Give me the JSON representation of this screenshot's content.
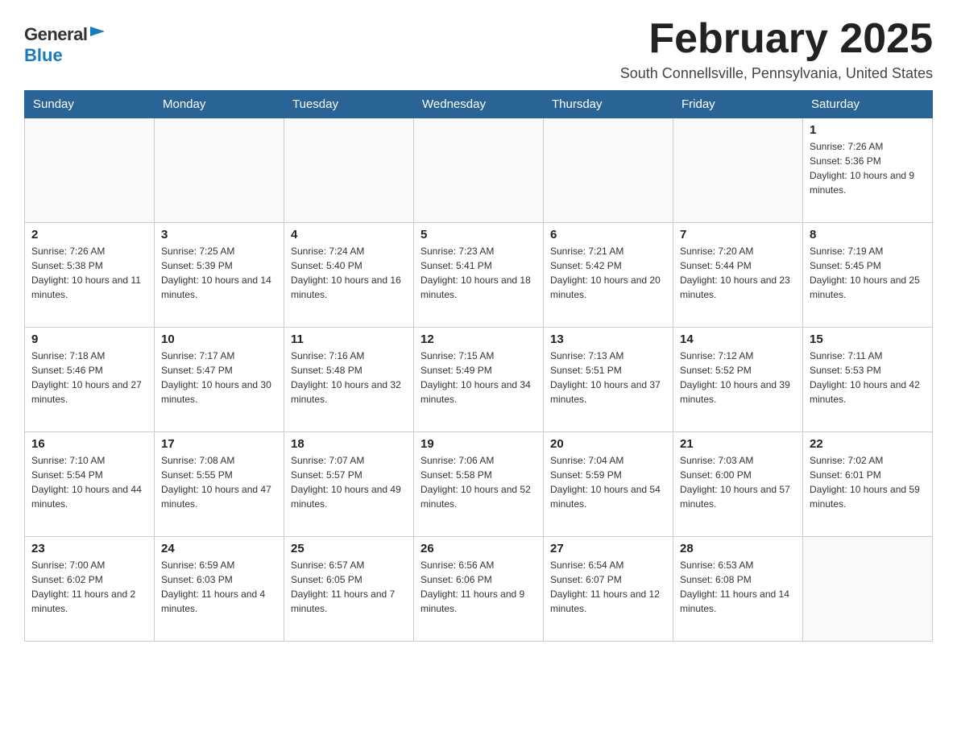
{
  "header": {
    "logo_general": "General",
    "logo_blue": "Blue",
    "month_title": "February 2025",
    "location": "South Connellsville, Pennsylvania, United States"
  },
  "days_of_week": [
    "Sunday",
    "Monday",
    "Tuesday",
    "Wednesday",
    "Thursday",
    "Friday",
    "Saturday"
  ],
  "weeks": [
    {
      "days": [
        {
          "number": "",
          "info": "",
          "empty": true
        },
        {
          "number": "",
          "info": "",
          "empty": true
        },
        {
          "number": "",
          "info": "",
          "empty": true
        },
        {
          "number": "",
          "info": "",
          "empty": true
        },
        {
          "number": "",
          "info": "",
          "empty": true
        },
        {
          "number": "",
          "info": "",
          "empty": true
        },
        {
          "number": "1",
          "info": "Sunrise: 7:26 AM\nSunset: 5:36 PM\nDaylight: 10 hours and 9 minutes."
        }
      ]
    },
    {
      "days": [
        {
          "number": "2",
          "info": "Sunrise: 7:26 AM\nSunset: 5:38 PM\nDaylight: 10 hours and 11 minutes."
        },
        {
          "number": "3",
          "info": "Sunrise: 7:25 AM\nSunset: 5:39 PM\nDaylight: 10 hours and 14 minutes."
        },
        {
          "number": "4",
          "info": "Sunrise: 7:24 AM\nSunset: 5:40 PM\nDaylight: 10 hours and 16 minutes."
        },
        {
          "number": "5",
          "info": "Sunrise: 7:23 AM\nSunset: 5:41 PM\nDaylight: 10 hours and 18 minutes."
        },
        {
          "number": "6",
          "info": "Sunrise: 7:21 AM\nSunset: 5:42 PM\nDaylight: 10 hours and 20 minutes."
        },
        {
          "number": "7",
          "info": "Sunrise: 7:20 AM\nSunset: 5:44 PM\nDaylight: 10 hours and 23 minutes."
        },
        {
          "number": "8",
          "info": "Sunrise: 7:19 AM\nSunset: 5:45 PM\nDaylight: 10 hours and 25 minutes."
        }
      ]
    },
    {
      "days": [
        {
          "number": "9",
          "info": "Sunrise: 7:18 AM\nSunset: 5:46 PM\nDaylight: 10 hours and 27 minutes."
        },
        {
          "number": "10",
          "info": "Sunrise: 7:17 AM\nSunset: 5:47 PM\nDaylight: 10 hours and 30 minutes."
        },
        {
          "number": "11",
          "info": "Sunrise: 7:16 AM\nSunset: 5:48 PM\nDaylight: 10 hours and 32 minutes."
        },
        {
          "number": "12",
          "info": "Sunrise: 7:15 AM\nSunset: 5:49 PM\nDaylight: 10 hours and 34 minutes."
        },
        {
          "number": "13",
          "info": "Sunrise: 7:13 AM\nSunset: 5:51 PM\nDaylight: 10 hours and 37 minutes."
        },
        {
          "number": "14",
          "info": "Sunrise: 7:12 AM\nSunset: 5:52 PM\nDaylight: 10 hours and 39 minutes."
        },
        {
          "number": "15",
          "info": "Sunrise: 7:11 AM\nSunset: 5:53 PM\nDaylight: 10 hours and 42 minutes."
        }
      ]
    },
    {
      "days": [
        {
          "number": "16",
          "info": "Sunrise: 7:10 AM\nSunset: 5:54 PM\nDaylight: 10 hours and 44 minutes."
        },
        {
          "number": "17",
          "info": "Sunrise: 7:08 AM\nSunset: 5:55 PM\nDaylight: 10 hours and 47 minutes."
        },
        {
          "number": "18",
          "info": "Sunrise: 7:07 AM\nSunset: 5:57 PM\nDaylight: 10 hours and 49 minutes."
        },
        {
          "number": "19",
          "info": "Sunrise: 7:06 AM\nSunset: 5:58 PM\nDaylight: 10 hours and 52 minutes."
        },
        {
          "number": "20",
          "info": "Sunrise: 7:04 AM\nSunset: 5:59 PM\nDaylight: 10 hours and 54 minutes."
        },
        {
          "number": "21",
          "info": "Sunrise: 7:03 AM\nSunset: 6:00 PM\nDaylight: 10 hours and 57 minutes."
        },
        {
          "number": "22",
          "info": "Sunrise: 7:02 AM\nSunset: 6:01 PM\nDaylight: 10 hours and 59 minutes."
        }
      ]
    },
    {
      "days": [
        {
          "number": "23",
          "info": "Sunrise: 7:00 AM\nSunset: 6:02 PM\nDaylight: 11 hours and 2 minutes."
        },
        {
          "number": "24",
          "info": "Sunrise: 6:59 AM\nSunset: 6:03 PM\nDaylight: 11 hours and 4 minutes."
        },
        {
          "number": "25",
          "info": "Sunrise: 6:57 AM\nSunset: 6:05 PM\nDaylight: 11 hours and 7 minutes."
        },
        {
          "number": "26",
          "info": "Sunrise: 6:56 AM\nSunset: 6:06 PM\nDaylight: 11 hours and 9 minutes."
        },
        {
          "number": "27",
          "info": "Sunrise: 6:54 AM\nSunset: 6:07 PM\nDaylight: 11 hours and 12 minutes."
        },
        {
          "number": "28",
          "info": "Sunrise: 6:53 AM\nSunset: 6:08 PM\nDaylight: 11 hours and 14 minutes."
        },
        {
          "number": "",
          "info": "",
          "empty": true
        }
      ]
    }
  ]
}
